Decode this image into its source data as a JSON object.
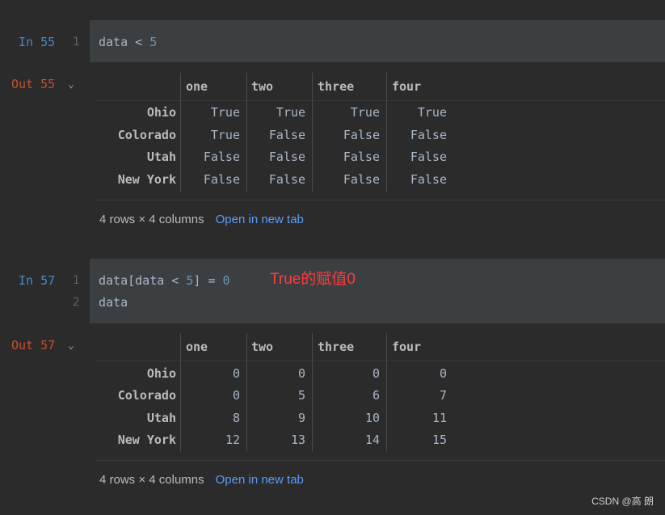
{
  "cells": [
    {
      "in_label": "In 55",
      "out_label": "Out 55",
      "code_lines": [
        {
          "lineno": "1",
          "text": "data < ",
          "num": "5",
          "rest": ""
        }
      ],
      "table": {
        "columns": [
          "one",
          "two",
          "three",
          "four"
        ],
        "rows": [
          {
            "index": "Ohio",
            "values": [
              "True",
              "True",
              "True",
              "True"
            ]
          },
          {
            "index": "Colorado",
            "values": [
              "True",
              "False",
              "False",
              "False"
            ]
          },
          {
            "index": "Utah",
            "values": [
              "False",
              "False",
              "False",
              "False"
            ]
          },
          {
            "index": "New York",
            "values": [
              "False",
              "False",
              "False",
              "False"
            ]
          }
        ]
      },
      "footer": {
        "shape": "4 rows × 4 columns",
        "link": "Open in new tab"
      }
    },
    {
      "in_label": "In 57",
      "out_label": "Out 57",
      "code_lines": [
        {
          "lineno": "1",
          "text": "data[data < ",
          "num": "5",
          "rest": "] = ",
          "num2": "0"
        },
        {
          "lineno": "2",
          "text": "data"
        }
      ],
      "annotation": "True的赋值0",
      "table": {
        "columns": [
          "one",
          "two",
          "three",
          "four"
        ],
        "rows": [
          {
            "index": "Ohio",
            "values": [
              "0",
              "0",
              "0",
              "0"
            ]
          },
          {
            "index": "Colorado",
            "values": [
              "0",
              "5",
              "6",
              "7"
            ]
          },
          {
            "index": "Utah",
            "values": [
              "8",
              "9",
              "10",
              "11"
            ]
          },
          {
            "index": "New York",
            "values": [
              "12",
              "13",
              "14",
              "15"
            ]
          }
        ]
      },
      "footer": {
        "shape": "4 rows × 4 columns",
        "link": "Open in new tab"
      }
    }
  ],
  "watermark": "CSDN @高 朗",
  "colors": {
    "background": "#2b2b2b",
    "code_cell": "#3c3f41",
    "in_prompt": "#4a88c7",
    "out_prompt": "#c7502e",
    "link": "#589df6",
    "annotation": "#ff3b3b"
  }
}
